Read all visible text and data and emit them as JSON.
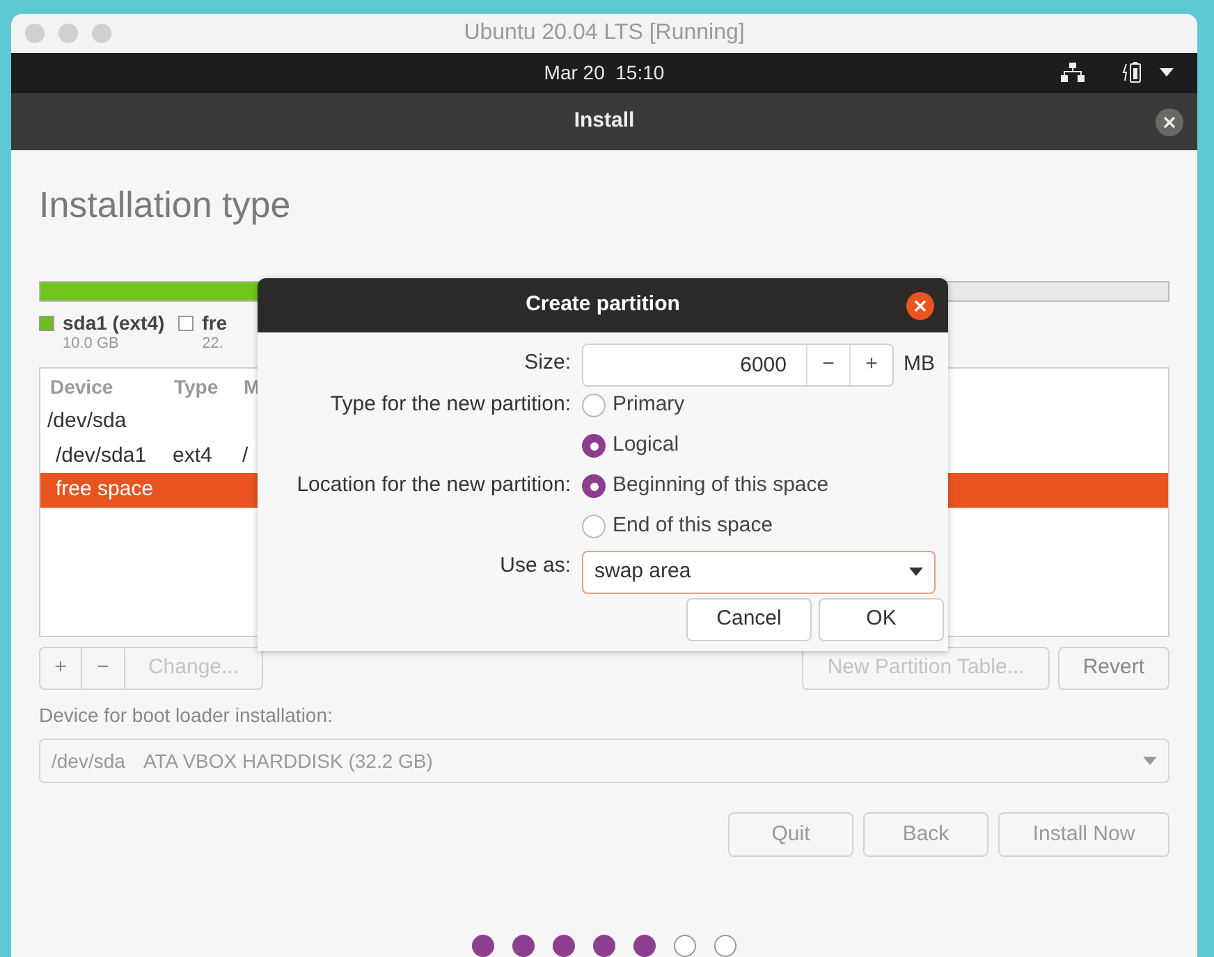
{
  "vm_window": {
    "title": "Ubuntu 20.04 LTS [Running]"
  },
  "top_bar": {
    "clock": "Mar 20  15:10"
  },
  "installer": {
    "title": "Install",
    "heading": "Installation type",
    "partition_bar": {
      "level": 0.31
    },
    "legend": [
      {
        "label": "sda1 (ext4)",
        "size": "10.0 GB",
        "color": "#6cbf1f"
      },
      {
        "label": "fre",
        "size": "22.",
        "color": "#ffffff"
      }
    ],
    "table": {
      "columns": [
        "Device",
        "Type",
        "M"
      ],
      "rows": [
        {
          "device": "/dev/sda",
          "selected": false,
          "children": [
            {
              "device": "/dev/sda1",
              "type": "ext4",
              "column_3": "/",
              "selected": false
            },
            {
              "device": "free space",
              "selected": true
            }
          ]
        }
      ]
    },
    "table_buttons": [
      {
        "label": "+",
        "disabled": false
      },
      {
        "label": "−",
        "disabled": false
      },
      {
        "label": "Change...",
        "disabled": true
      }
    ],
    "table_buttons_right": [
      {
        "label": "New Partition Table...",
        "disabled": true
      },
      {
        "label": "Revert",
        "disabled": false
      }
    ],
    "boot_loader": {
      "label": "Device for boot loader installation:",
      "device": "/dev/sda",
      "description": "ATA VBOX HARDDISK (32.2 GB)"
    },
    "buttons": [
      "Quit",
      "Back",
      "Install Now"
    ],
    "steps": [
      {
        "done": true
      },
      {
        "done": true
      },
      {
        "done": true
      },
      {
        "done": true
      },
      {
        "done": true
      },
      {
        "done": false
      },
      {
        "done": false
      }
    ]
  },
  "dialog": {
    "title": "Create partition",
    "size": {
      "label": "Size:",
      "value": "6000",
      "minus": "−",
      "plus": "+",
      "unit": "MB"
    },
    "type": {
      "label": "Type for the new partition:",
      "options": [
        {
          "label": "Primary",
          "selected": false
        },
        {
          "label": "Logical",
          "selected": true
        }
      ]
    },
    "location": {
      "label": "Location for the new partition:",
      "options": [
        {
          "label": "Beginning of this space",
          "selected": true
        },
        {
          "label": "End of this space",
          "selected": false
        }
      ]
    },
    "use_as": {
      "label": "Use as:",
      "value": "swap area"
    },
    "buttons": [
      "Cancel",
      "OK"
    ]
  }
}
